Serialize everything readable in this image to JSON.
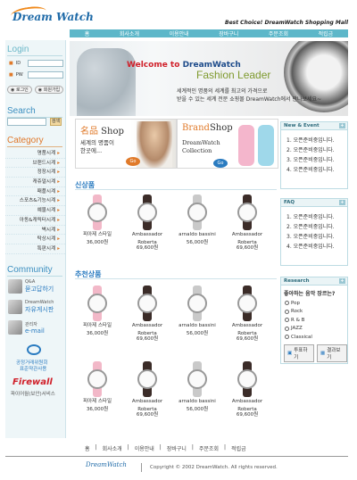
{
  "header": {
    "logo_text": "Dream Watch",
    "slogan": "Best Choice! DreamWatch Shopping Mall",
    "nav": [
      "홈",
      "회사소개",
      "이용안내",
      "장바구니",
      "주문조회",
      "적립금"
    ]
  },
  "login": {
    "title": "Login",
    "id_label": "ID",
    "pw_label": "PW",
    "login_button": "로그인",
    "join_button": "회원가입"
  },
  "search": {
    "title": "Search",
    "button": "검색"
  },
  "category": {
    "title": "Category",
    "items": [
      "명품시계",
      "브랜드시계",
      "정장시계",
      "캐쥬얼시계",
      "패플시계",
      "스포츠&기능시계",
      "예물시계",
      "아동&캐릭터시계",
      "벽시계",
      "탁상시계",
      "특판시계"
    ]
  },
  "community": {
    "title": "Community",
    "items": [
      {
        "label": "Q&A",
        "link": "묻고답하기"
      },
      {
        "label": "DreamWatch",
        "link": "자유게시판"
      },
      {
        "label": "관리자",
        "link": "e-mail"
      }
    ],
    "badge1_line1": "공정거래위원회",
    "badge1_line2": "표준약관사용",
    "badge2_brand": "Firewall",
    "badge2_sub": "파이어월(보안)서비스"
  },
  "banner": {
    "welcome_prefix": "Welcome to ",
    "welcome_brand": "DreamWatch",
    "subtitle": "Fashion Leader",
    "line1": "세계적인 명품의 세계를 최고의 가격으로",
    "line2": "받을 수 있는 세계 전문 쇼핑몰 DreamWatch에서 만나보세요~"
  },
  "promos": [
    {
      "title_hl": "名品",
      "title_rest": " Shop",
      "sub1": "세계의 명품이",
      "sub2": "한곳에...",
      "go": "Go"
    },
    {
      "title_hl": "Brand",
      "title_rest": "Shop",
      "sub1": "DreamWatch",
      "sub2": "Collection",
      "go": "Go"
    }
  ],
  "new_products": {
    "title": "신상품",
    "items": [
      {
        "name": "피아제 스타일",
        "name2": "",
        "price": "36,000원",
        "color": "#f2b8c8"
      },
      {
        "name": "Ambassador",
        "name2": "Roberta",
        "price": "69,600원",
        "color": "#3b2c28"
      },
      {
        "name": "arnaldo bassini",
        "name2": "",
        "price": "56,000원",
        "color": "#c9c9c9"
      },
      {
        "name": "Ambassador",
        "name2": "Roberta",
        "price": "69,600원",
        "color": "#3b2c28"
      }
    ]
  },
  "recommended": {
    "title": "추천상품",
    "rows": [
      [
        {
          "name": "피아제 스타일",
          "name2": "",
          "price": "36,000원",
          "color": "#f2b8c8"
        },
        {
          "name": "Ambassador",
          "name2": "Roberta",
          "price": "69,600원",
          "color": "#3b2c28"
        },
        {
          "name": "arnaldo bassini",
          "name2": "",
          "price": "56,000원",
          "color": "#c9c9c9"
        },
        {
          "name": "Ambassador",
          "name2": "Roberta",
          "price": "69,600원",
          "color": "#3b2c28"
        }
      ],
      [
        {
          "name": "피아제 스타일",
          "name2": "",
          "price": "36,000원",
          "color": "#f2b8c8"
        },
        {
          "name": "Ambassador",
          "name2": "Roberta",
          "price": "69,600원",
          "color": "#3b2c28"
        },
        {
          "name": "arnaldo bassini",
          "name2": "",
          "price": "56,000원",
          "color": "#c9c9c9"
        },
        {
          "name": "Ambassador",
          "name2": "Roberta",
          "price": "69,600원",
          "color": "#3b2c28"
        }
      ]
    ]
  },
  "news": {
    "title": "New & Event",
    "plus": "+",
    "items": [
      "1. 오픈준비중입니다.",
      "2. 오픈준비중입니다.",
      "3. 오픈준비중입니다.",
      "4. 오픈준비중입니다."
    ]
  },
  "faq": {
    "title": "FAQ",
    "plus": "+",
    "items": [
      "1. 오픈준비중입니다.",
      "2. 오픈준비중입니다.",
      "3. 오픈준비중입니다.",
      "4. 오픈준비중입니다."
    ]
  },
  "research": {
    "title": "Research",
    "plus": "+",
    "question": "좋아하는 음악 장르는?",
    "options": [
      "Pop",
      "Rock",
      "R & B",
      "JAZZ",
      "Classical"
    ],
    "vote_button": "투표하기",
    "result_button": "결과보기"
  },
  "footer": {
    "nav": [
      "홈",
      "회사소개",
      "이용안내",
      "장바구니",
      "주문조회",
      "적립금"
    ],
    "logo_text": "DreamWatch",
    "copyright": "Copyright © 2002 DreamWatch. All rights reserved."
  },
  "colors": {
    "nav_bg": "#5db7c9",
    "accent_orange": "#e07a2a",
    "link_blue": "#2a7bc0"
  }
}
